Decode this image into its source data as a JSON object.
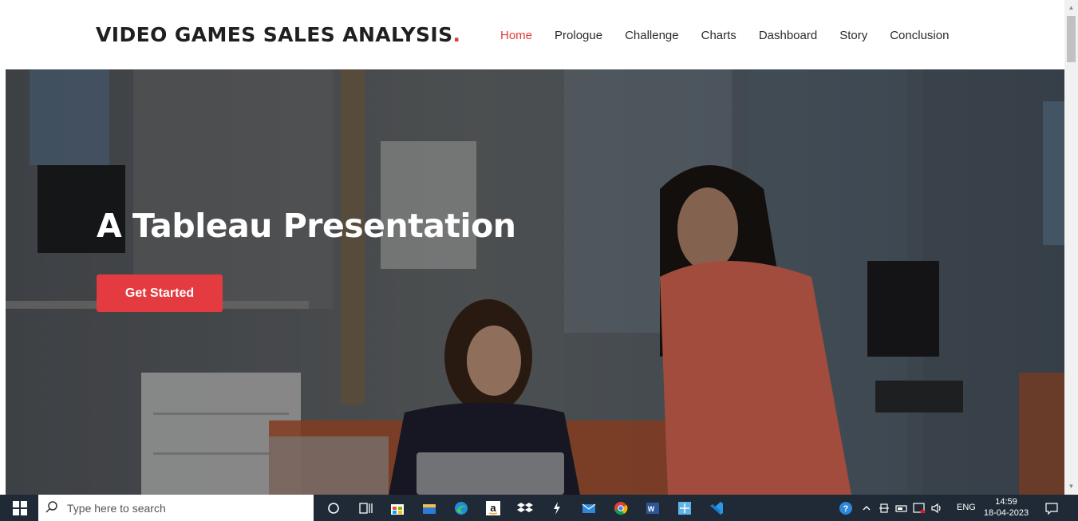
{
  "header": {
    "logo_text": "VIDEO GAMES SALES ANALYSIS",
    "logo_dot": ".",
    "nav": [
      {
        "label": "Home",
        "active": true
      },
      {
        "label": "Prologue",
        "active": false
      },
      {
        "label": "Challenge",
        "active": false
      },
      {
        "label": "Charts",
        "active": false
      },
      {
        "label": "Dashboard",
        "active": false
      },
      {
        "label": "Story",
        "active": false
      },
      {
        "label": "Conclusion",
        "active": false
      }
    ]
  },
  "hero": {
    "title": "A Tableau Presentation",
    "cta_label": "Get Started",
    "image": "office-photo-two-women-laptop"
  },
  "colors": {
    "accent": "#e03a3c",
    "taskbar": "#1f2a36"
  },
  "taskbar": {
    "search_placeholder": "Type here to search",
    "apps": [
      "cortana-icon",
      "task-view-icon",
      "store-icon",
      "file-explorer-icon",
      "edge-icon",
      "amazon-icon",
      "dropbox-icon",
      "tableau-icon",
      "mail-icon",
      "chrome-icon",
      "word-icon",
      "snipping-icon",
      "vscode-icon"
    ],
    "tray": {
      "language": "ENG",
      "time": "14:59",
      "date": "18-04-2023"
    }
  }
}
